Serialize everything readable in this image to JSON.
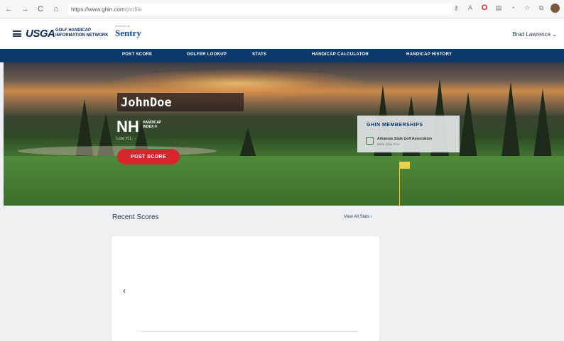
{
  "browser": {
    "url_host": "https://www.ghin.com",
    "url_path": "/profile",
    "back_icon": "←",
    "forward_icon": "→",
    "reload_icon": "C",
    "home_icon": "⌂",
    "lock_icon": "🔒"
  },
  "header": {
    "usga_logo": "USGA",
    "ghin_line1": "GOLF HANDICAP",
    "ghin_line2": "INFORMATION NETWORK",
    "powered_by": "powered by",
    "sponsor": "Sentry",
    "user_name": "Brad Lawrence"
  },
  "nav": {
    "items": [
      "POST SCORE",
      "GOLFER LOOKUP",
      "STATS",
      "HANDICAP CALCULATOR",
      "HANDICAP HISTORY"
    ]
  },
  "profile": {
    "name": "JohnDoe",
    "handicap_index": "NH",
    "handicap_label_1": "HANDICAP",
    "handicap_label_2": "INDEX ®",
    "low_hi": "Low H.I.: -",
    "post_score_button": "POST SCORE"
  },
  "memberships": {
    "title": "GHIN MEMBERSHIPS",
    "association": "Arkansas State Golf Association",
    "club": "Bella Vista POA"
  },
  "scores": {
    "title": "Recent Scores",
    "view_all": "View All Stats ›",
    "prev_icon": "‹"
  },
  "colors": {
    "nav_bg": "#0b3a6a",
    "accent_red": "#d8262c",
    "brand_blue": "#0b2a5a"
  }
}
